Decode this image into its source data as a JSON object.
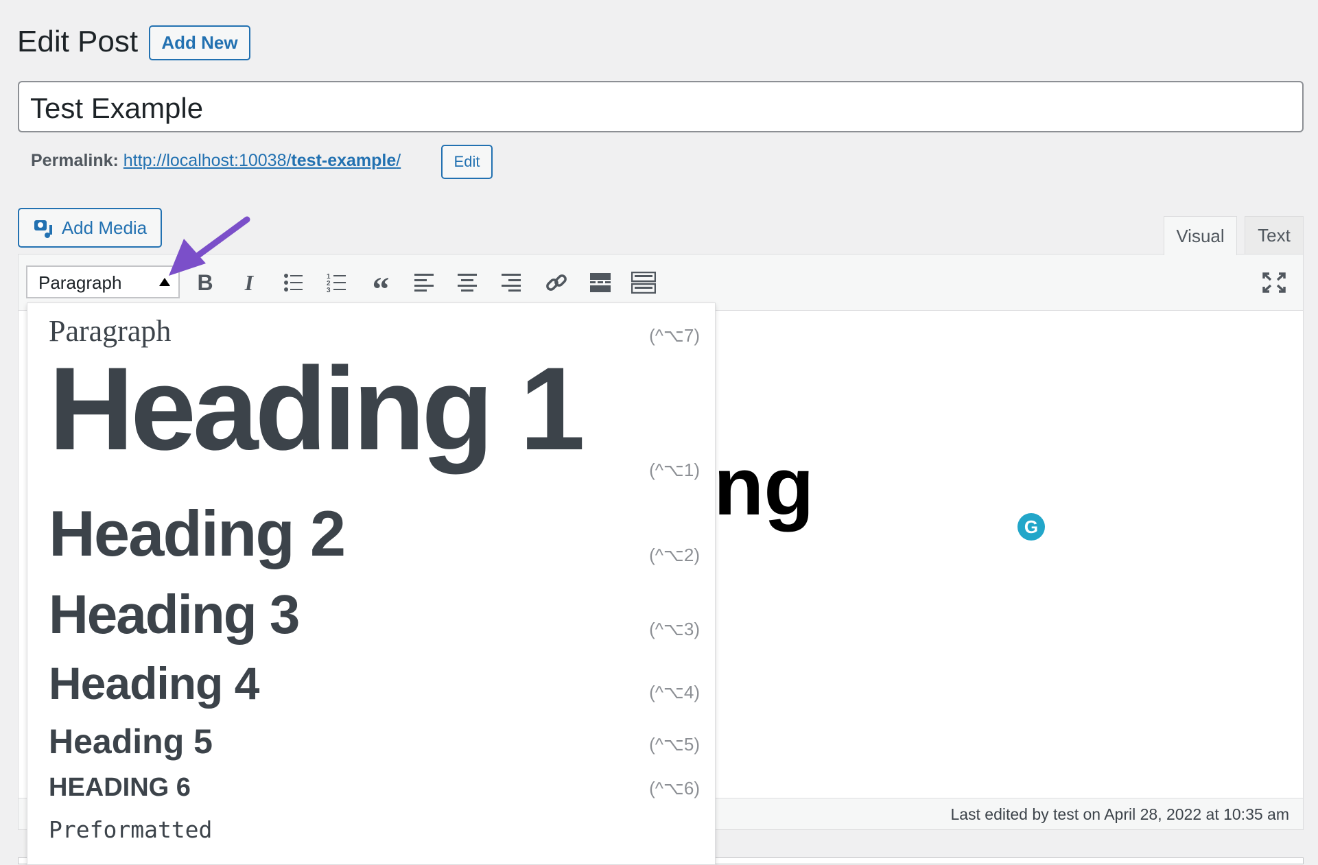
{
  "header": {
    "title": "Edit Post",
    "add_new": "Add New"
  },
  "post": {
    "title": "Test Example",
    "permalink_label": "Permalink:",
    "permalink_base": "http://localhost:10038/",
    "permalink_slug": "test-example",
    "permalink_trail": "/",
    "edit_label": "Edit"
  },
  "editor": {
    "add_media": "Add Media",
    "tabs": [
      "Visual",
      "Text"
    ],
    "active_tab": "Visual",
    "format_value": "Paragraph",
    "background_text": "ng",
    "status": "Last edited by test on April 28, 2022 at 10:35 am"
  },
  "toolbar": [
    "bold",
    "italic",
    "bulleted-list",
    "numbered-list",
    "blockquote",
    "align-left",
    "align-center",
    "align-right",
    "link",
    "read-more",
    "toolbar-toggle",
    "fullscreen"
  ],
  "dropdown": {
    "items": [
      {
        "label": "Paragraph",
        "shortcut": "(^⌥7)"
      },
      {
        "label": "Heading 1",
        "shortcut": "(^⌥1)"
      },
      {
        "label": "Heading 2",
        "shortcut": "(^⌥2)"
      },
      {
        "label": "Heading 3",
        "shortcut": "(^⌥3)"
      },
      {
        "label": "Heading 4",
        "shortcut": "(^⌥4)"
      },
      {
        "label": "Heading 5",
        "shortcut": "(^⌥5)"
      },
      {
        "label": "HEADING 6",
        "shortcut": "(^⌥6)"
      },
      {
        "label": "Preformatted"
      }
    ]
  },
  "colors": {
    "accent": "#2271b1",
    "annotation_arrow": "#7b4fc9",
    "grammarly": "#22a6c9"
  }
}
